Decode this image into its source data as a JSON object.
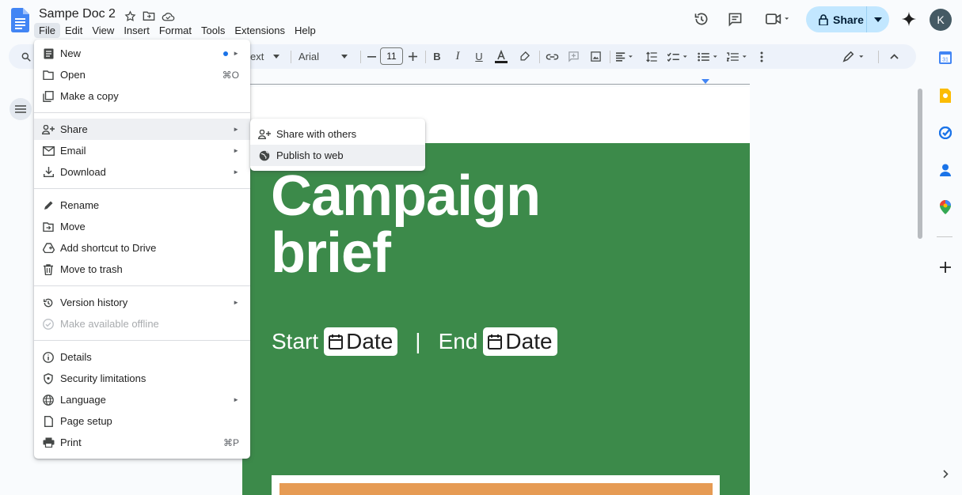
{
  "doc": {
    "title": "Sampe Doc 2"
  },
  "menubar": [
    "File",
    "Edit",
    "View",
    "Insert",
    "Format",
    "Tools",
    "Extensions",
    "Help"
  ],
  "header": {
    "share_label": "Share",
    "avatar_initial": "K"
  },
  "toolbar": {
    "style_fragment": "ext",
    "font": "Arial",
    "font_size": "11"
  },
  "file_menu": {
    "items": [
      {
        "label": "New",
        "icon": "new-doc-icon",
        "arrow": "►"
      },
      {
        "label": "Open",
        "icon": "folder-icon",
        "shortcut": "⌘O"
      },
      {
        "label": "Make a copy",
        "icon": "copy-icon"
      },
      {
        "label": "Share",
        "icon": "person-add-icon",
        "arrow": "►"
      },
      {
        "label": "Email",
        "icon": "email-icon",
        "arrow": "►"
      },
      {
        "label": "Download",
        "icon": "download-icon",
        "arrow": "►"
      },
      {
        "label": "Rename",
        "icon": "pencil-icon"
      },
      {
        "label": "Move",
        "icon": "move-folder-icon"
      },
      {
        "label": "Add shortcut to Drive",
        "icon": "drive-shortcut-icon"
      },
      {
        "label": "Move to trash",
        "icon": "trash-icon"
      },
      {
        "label": "Version history",
        "icon": "history-icon",
        "arrow": "►"
      },
      {
        "label": "Make available offline",
        "icon": "offline-icon"
      },
      {
        "label": "Details",
        "icon": "info-icon"
      },
      {
        "label": "Security limitations",
        "icon": "shield-icon"
      },
      {
        "label": "Language",
        "icon": "globe-icon",
        "arrow": "►"
      },
      {
        "label": "Page setup",
        "icon": "page-icon"
      },
      {
        "label": "Print",
        "icon": "print-icon",
        "shortcut": "⌘P"
      }
    ]
  },
  "share_submenu": {
    "items": [
      {
        "label": "Share with others",
        "icon": "person-add-icon"
      },
      {
        "label": "Publish to web",
        "icon": "globe-icon"
      }
    ]
  },
  "document": {
    "title_line1": "Campaign",
    "title_line2": "brief",
    "start_label": "Start",
    "end_label": "End",
    "date_chip": "Date",
    "separator": "|"
  },
  "colors": {
    "banner_green": "#3c8a4a",
    "accent_orange": "#e69b54",
    "share_button": "#c2e7ff"
  }
}
